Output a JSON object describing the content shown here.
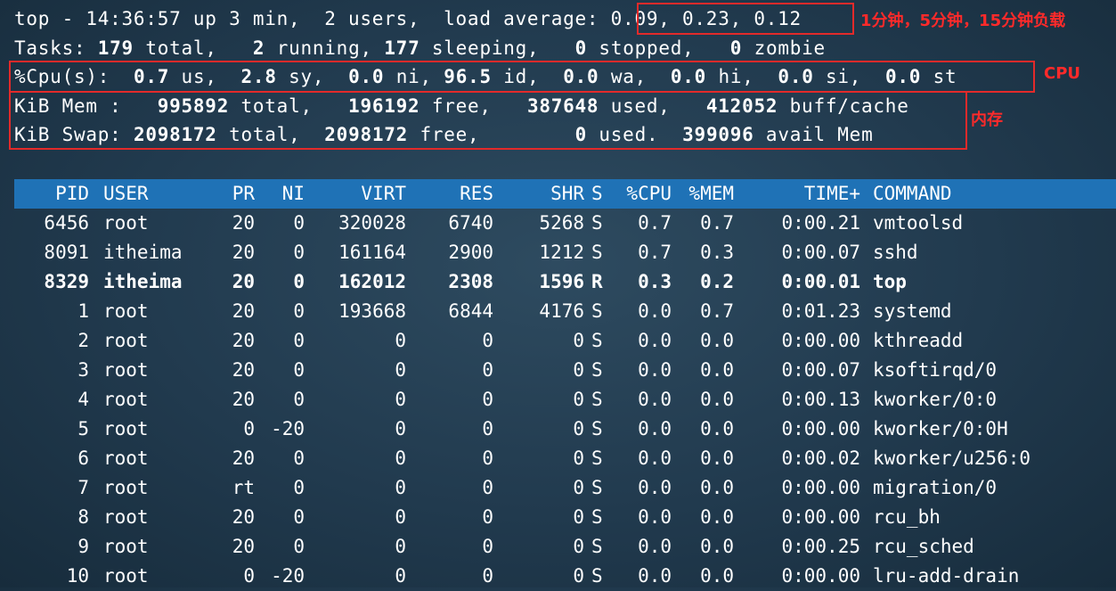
{
  "summary": {
    "line1": "top - 14:36:57 up 3 min,  2 users,  load average: 0.09, 0.23, 0.12",
    "tasks": {
      "label": "Tasks:",
      "total_val": "179",
      "total_lbl": "total,",
      "running_val": "2",
      "running_lbl": "running,",
      "sleeping_val": "177",
      "sleeping_lbl": "sleeping,",
      "stopped_val": "0",
      "stopped_lbl": "stopped,",
      "zombie_val": "0",
      "zombie_lbl": "zombie"
    },
    "cpu": {
      "label": "%Cpu(s):",
      "us_val": "0.7",
      "us_lbl": "us,",
      "sy_val": "2.8",
      "sy_lbl": "sy,",
      "ni_val": "0.0",
      "ni_lbl": "ni,",
      "id_val": "96.5",
      "id_lbl": "id,",
      "wa_val": "0.0",
      "wa_lbl": "wa,",
      "hi_val": "0.0",
      "hi_lbl": "hi,",
      "si_val": "0.0",
      "si_lbl": "si,",
      "st_val": "0.0",
      "st_lbl": "st"
    },
    "mem": {
      "label": "KiB Mem :",
      "total_val": "995892",
      "total_lbl": "total,",
      "free_val": "196192",
      "free_lbl": "free,",
      "used_val": "387648",
      "used_lbl": "used,",
      "buff_val": "412052",
      "buff_lbl": "buff/cache"
    },
    "swap": {
      "label": "KiB Swap:",
      "total_val": "2098172",
      "total_lbl": "total,",
      "free_val": "2098172",
      "free_lbl": "free,",
      "used_val": "0",
      "used_lbl": "used.",
      "avail_val": "399096",
      "avail_lbl": "avail Mem"
    }
  },
  "annotations": {
    "load": "1分钟，5分钟，15分钟负载",
    "cpu": "CPU",
    "mem": "内存"
  },
  "annotation_color": "#e32a2a",
  "header_bg_color": "#1f72b6",
  "table": {
    "columns": [
      "PID",
      "USER",
      "PR",
      "NI",
      "VIRT",
      "RES",
      "SHR",
      "S",
      "%CPU",
      "%MEM",
      "TIME+",
      "COMMAND"
    ],
    "rows": [
      {
        "pid": "6456",
        "user": "root",
        "pr": "20",
        "ni": "0",
        "virt": "320028",
        "res": "6740",
        "shr": "5268",
        "s": "S",
        "cpu": "0.7",
        "mem": "0.7",
        "time": "0:00.21",
        "cmd": "vmtoolsd"
      },
      {
        "pid": "8091",
        "user": "itheima",
        "pr": "20",
        "ni": "0",
        "virt": "161164",
        "res": "2900",
        "shr": "1212",
        "s": "S",
        "cpu": "0.7",
        "mem": "0.3",
        "time": "0:00.07",
        "cmd": "sshd"
      },
      {
        "pid": "8329",
        "user": "itheima",
        "pr": "20",
        "ni": "0",
        "virt": "162012",
        "res": "2308",
        "shr": "1596",
        "s": "R",
        "cpu": "0.3",
        "mem": "0.2",
        "time": "0:00.01",
        "cmd": "top"
      },
      {
        "pid": "1",
        "user": "root",
        "pr": "20",
        "ni": "0",
        "virt": "193668",
        "res": "6844",
        "shr": "4176",
        "s": "S",
        "cpu": "0.0",
        "mem": "0.7",
        "time": "0:01.23",
        "cmd": "systemd"
      },
      {
        "pid": "2",
        "user": "root",
        "pr": "20",
        "ni": "0",
        "virt": "0",
        "res": "0",
        "shr": "0",
        "s": "S",
        "cpu": "0.0",
        "mem": "0.0",
        "time": "0:00.00",
        "cmd": "kthreadd"
      },
      {
        "pid": "3",
        "user": "root",
        "pr": "20",
        "ni": "0",
        "virt": "0",
        "res": "0",
        "shr": "0",
        "s": "S",
        "cpu": "0.0",
        "mem": "0.0",
        "time": "0:00.07",
        "cmd": "ksoftirqd/0"
      },
      {
        "pid": "4",
        "user": "root",
        "pr": "20",
        "ni": "0",
        "virt": "0",
        "res": "0",
        "shr": "0",
        "s": "S",
        "cpu": "0.0",
        "mem": "0.0",
        "time": "0:00.13",
        "cmd": "kworker/0:0"
      },
      {
        "pid": "5",
        "user": "root",
        "pr": "0",
        "ni": "-20",
        "virt": "0",
        "res": "0",
        "shr": "0",
        "s": "S",
        "cpu": "0.0",
        "mem": "0.0",
        "time": "0:00.00",
        "cmd": "kworker/0:0H"
      },
      {
        "pid": "6",
        "user": "root",
        "pr": "20",
        "ni": "0",
        "virt": "0",
        "res": "0",
        "shr": "0",
        "s": "S",
        "cpu": "0.0",
        "mem": "0.0",
        "time": "0:00.02",
        "cmd": "kworker/u256:0"
      },
      {
        "pid": "7",
        "user": "root",
        "pr": "rt",
        "ni": "0",
        "virt": "0",
        "res": "0",
        "shr": "0",
        "s": "S",
        "cpu": "0.0",
        "mem": "0.0",
        "time": "0:00.00",
        "cmd": "migration/0"
      },
      {
        "pid": "8",
        "user": "root",
        "pr": "20",
        "ni": "0",
        "virt": "0",
        "res": "0",
        "shr": "0",
        "s": "S",
        "cpu": "0.0",
        "mem": "0.0",
        "time": "0:00.00",
        "cmd": "rcu_bh"
      },
      {
        "pid": "9",
        "user": "root",
        "pr": "20",
        "ni": "0",
        "virt": "0",
        "res": "0",
        "shr": "0",
        "s": "S",
        "cpu": "0.0",
        "mem": "0.0",
        "time": "0:00.25",
        "cmd": "rcu_sched"
      },
      {
        "pid": "10",
        "user": "root",
        "pr": "0",
        "ni": "-20",
        "virt": "0",
        "res": "0",
        "shr": "0",
        "s": "S",
        "cpu": "0.0",
        "mem": "0.0",
        "time": "0:00.00",
        "cmd": "lru-add-drain"
      }
    ]
  }
}
